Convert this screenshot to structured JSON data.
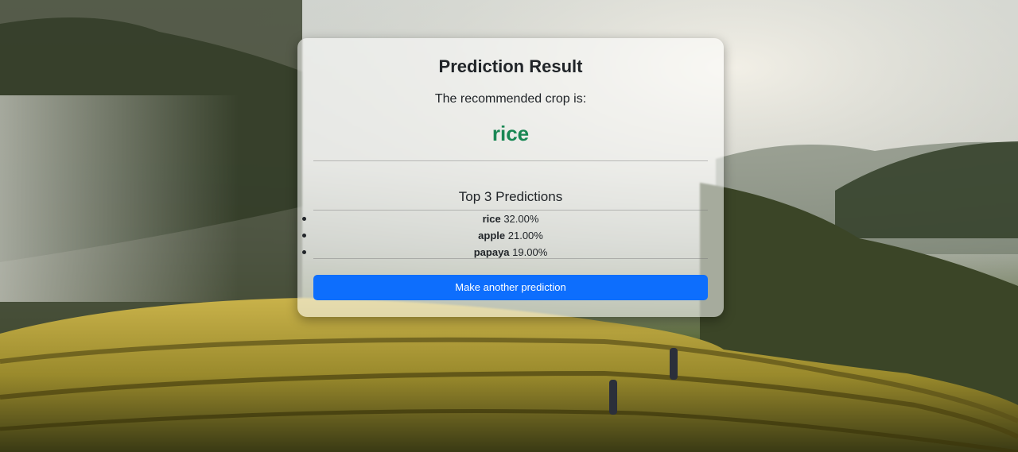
{
  "result": {
    "title": "Prediction Result",
    "subtitle": "The recommended crop is:",
    "crop": "rice",
    "crop_color": "#198754"
  },
  "top_predictions": {
    "heading": "Top 3 Predictions",
    "items": [
      {
        "name": "rice",
        "percent": "32.00%"
      },
      {
        "name": "apple",
        "percent": "21.00%"
      },
      {
        "name": "papaya",
        "percent": "19.00%"
      }
    ]
  },
  "actions": {
    "another_label": "Make another prediction",
    "button_color": "#0d6efd"
  }
}
